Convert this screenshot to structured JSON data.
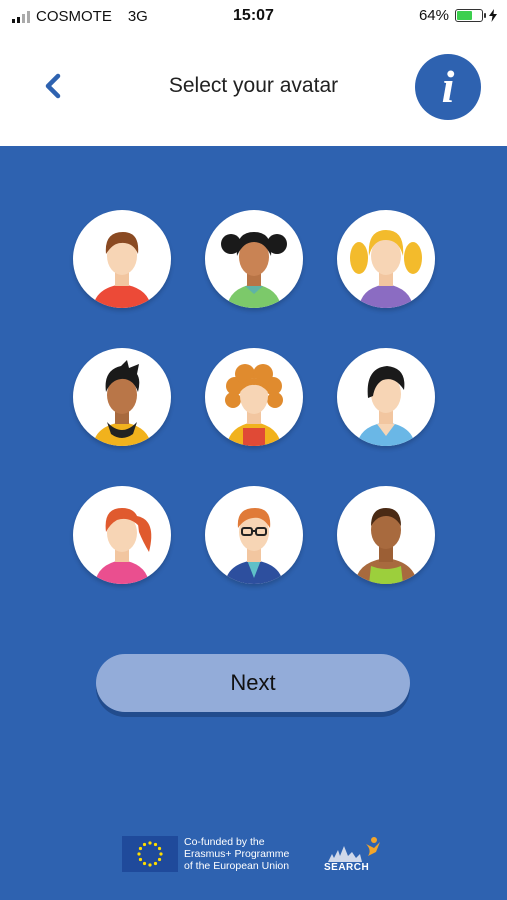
{
  "status_bar": {
    "carrier": "COSMOTE",
    "network": "3G",
    "time": "15:07",
    "battery_percent": "64%",
    "battery_level": 0.64
  },
  "header": {
    "title": "Select your avatar",
    "back_icon": "chevron-left-icon",
    "info_icon": "info-icon",
    "info_glyph": "i",
    "accent_color": "#2e62b0"
  },
  "avatars": [
    {
      "id": "boy-brown-hair"
    },
    {
      "id": "girl-black-pigtails"
    },
    {
      "id": "girl-blonde-pigtails"
    },
    {
      "id": "boy-black-spiky-hair"
    },
    {
      "id": "girl-curly-orange-hair"
    },
    {
      "id": "boy-black-hair-blue-shirt"
    },
    {
      "id": "girl-red-ponytail"
    },
    {
      "id": "boy-glasses-ginger"
    },
    {
      "id": "man-short-hair-tank-top"
    }
  ],
  "next_button": {
    "label": "Next"
  },
  "footer": {
    "eu_line1": "Co-funded by the",
    "eu_line2": "Erasmus+ Programme",
    "eu_line3": "of the European Union",
    "search_label": "SEARCH"
  }
}
